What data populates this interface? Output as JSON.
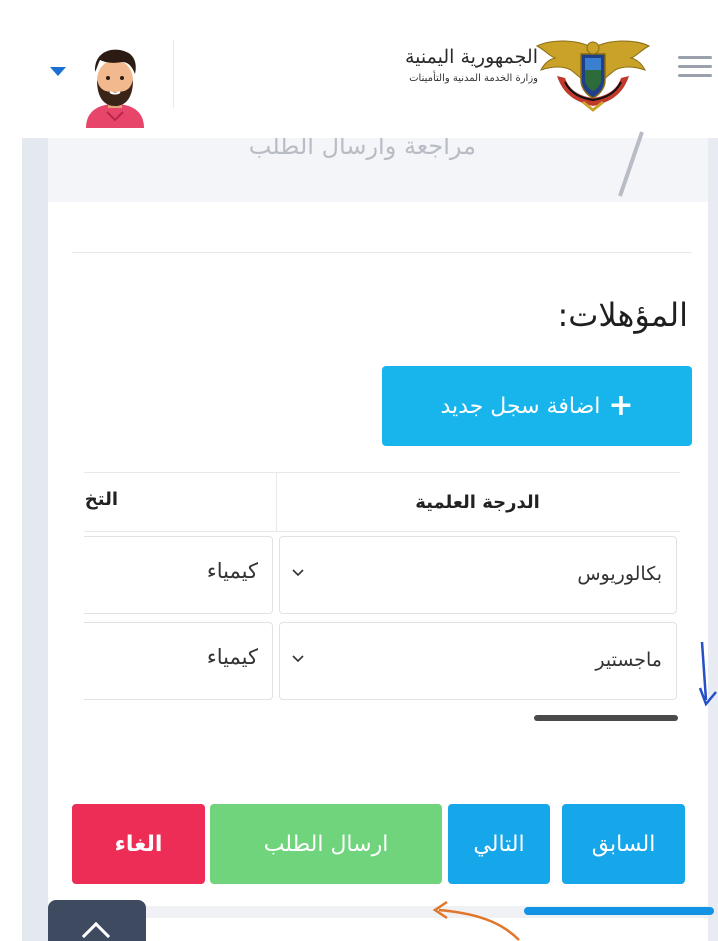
{
  "header": {
    "ministry_title": "الجمهورية اليمنية",
    "ministry_name": "وزارة الخدمة المدنية والتأمينات"
  },
  "step": {
    "label": "مراجعة وارسال الطلب"
  },
  "qualifications": {
    "title": "المؤهلات:",
    "add_button_label": "اضافة سجل جديد",
    "columns": [
      "الدرجة العلمية",
      "التخ"
    ],
    "rows": [
      {
        "degree": "بكالوريوس",
        "specialization": "كيمياء"
      },
      {
        "degree": "ماجستير",
        "specialization": "كيمياء"
      }
    ]
  },
  "actions": {
    "prev_label": "السابق",
    "next_label": "التالي",
    "submit_label": "ارسال الطلب",
    "cancel_label": "الغاء"
  },
  "colors": {
    "primary": "#16a6ea",
    "add_button": "#18b4ec",
    "submit": "#6fd47c",
    "cancel": "#ee2d56"
  }
}
